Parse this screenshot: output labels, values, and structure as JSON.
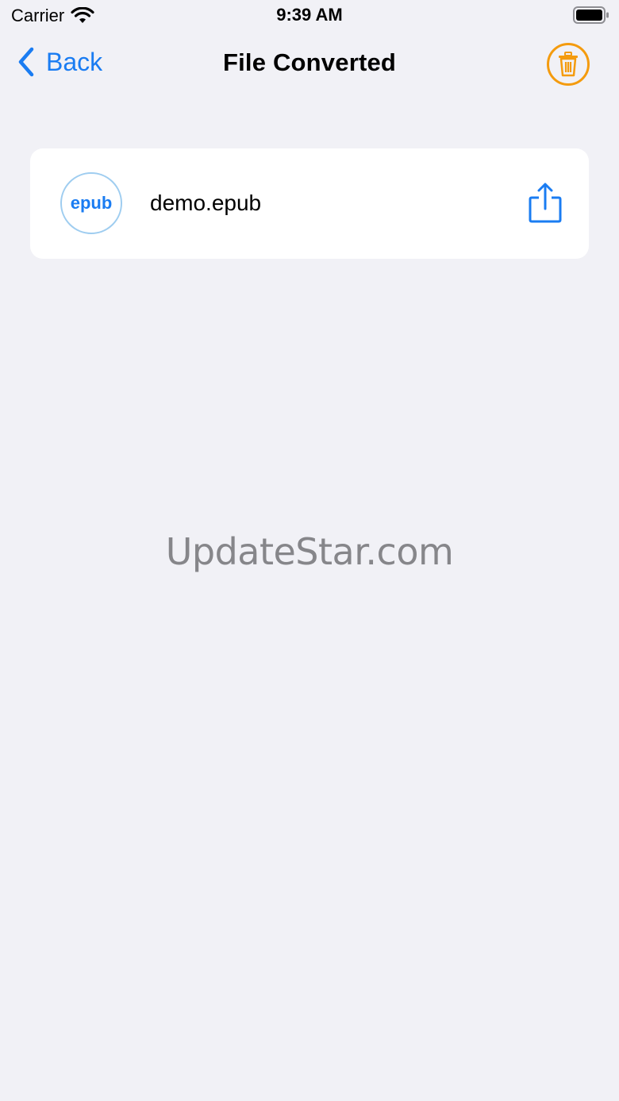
{
  "status_bar": {
    "carrier": "Carrier",
    "time": "9:39 AM"
  },
  "nav": {
    "back_label": "Back",
    "title": "File Converted"
  },
  "files": [
    {
      "badge": "epub",
      "name": "demo.epub"
    }
  ],
  "watermark": "UpdateStar.com",
  "colors": {
    "background": "#f1f1f6",
    "accent_blue": "#1a7cf2",
    "trash_orange": "#f49b0e",
    "badge_border": "#9fcdf0"
  },
  "icons": {
    "wifi": "wifi-icon",
    "battery": "battery-icon",
    "back": "chevron-left-icon",
    "trash": "trash-icon",
    "share": "share-icon"
  }
}
